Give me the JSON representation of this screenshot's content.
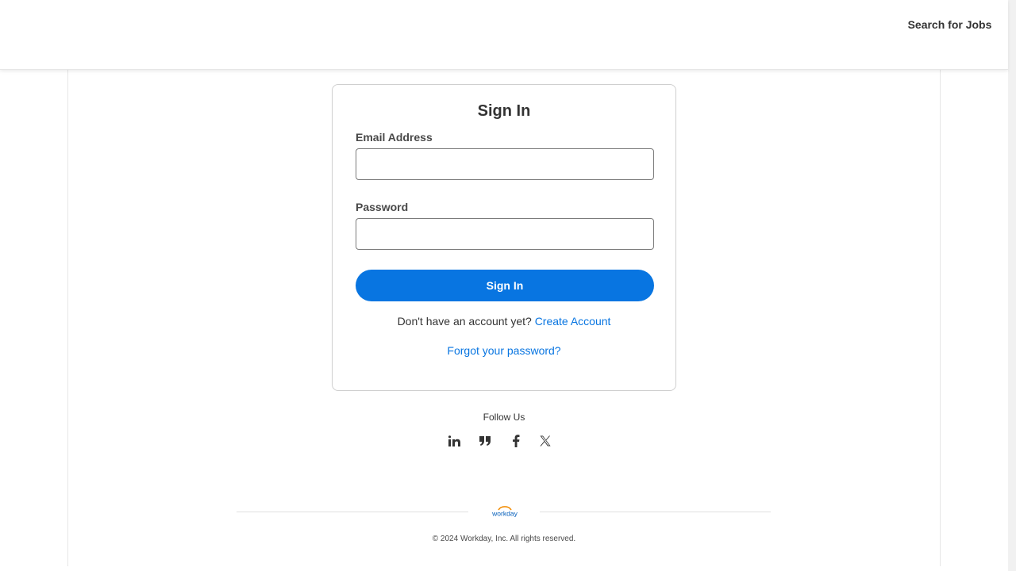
{
  "header": {
    "search_jobs_label": "Search for Jobs"
  },
  "signin_card": {
    "title": "Sign In",
    "email_label": "Email Address",
    "email_value": "",
    "password_label": "Password",
    "password_value": "",
    "signin_button_label": "Sign In",
    "no_account_text": "Don't have an account yet?",
    "create_account_label": "Create Account",
    "forgot_password_label": "Forgot your password?"
  },
  "follow": {
    "title": "Follow Us",
    "icons": [
      "linkedin-icon",
      "blog-icon",
      "facebook-icon",
      "x-twitter-icon"
    ]
  },
  "footer": {
    "logo_text": "workday",
    "copyright": "© 2024 Workday, Inc. All rights reserved."
  },
  "colors": {
    "accent": "#0875e1",
    "text": "#333333",
    "logo_orange": "#f38b00",
    "logo_blue": "#005cb9"
  }
}
